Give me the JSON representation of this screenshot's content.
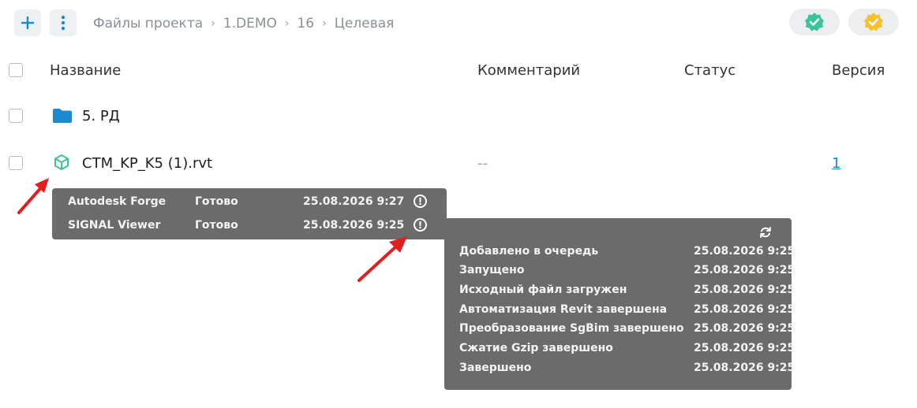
{
  "toolbar": {
    "add_icon": "plus-icon",
    "menu_icon": "vertical-dots-icon"
  },
  "breadcrumb": [
    "Файлы проекта",
    "1.DEMO",
    "16",
    "Целевая"
  ],
  "status_pills": [
    {
      "icon": "check-badge-icon",
      "color": "#3cc39a"
    },
    {
      "icon": "check-badge-icon",
      "color": "#f2c230"
    }
  ],
  "table": {
    "headers": {
      "name": "Название",
      "comment": "Комментарий",
      "status": "Статус",
      "version": "Версия"
    },
    "rows": [
      {
        "type": "folder",
        "name": "5. РД"
      },
      {
        "type": "model",
        "name": "CTM_KP_K5 (1).rvt",
        "comment": "--",
        "version": "1"
      }
    ]
  },
  "viewer_tooltip": {
    "rows": [
      {
        "viewer": "Autodesk Forge",
        "status": "Готово",
        "time": "25.08.2026 9:27"
      },
      {
        "viewer": "SIGNAL Viewer",
        "status": "Готово",
        "time": "25.08.2026 9:25"
      }
    ]
  },
  "process_tooltip": {
    "refresh_icon": "refresh-icon",
    "steps": [
      {
        "label": "Добавлено в очередь",
        "time": "25.08.2026 9:25"
      },
      {
        "label": "Запущено",
        "time": "25.08.2026 9:25"
      },
      {
        "label": "Исходный файл загружен",
        "time": "25.08.2026 9:25"
      },
      {
        "label": "Автоматизация Revit завершена",
        "time": "25.08.2026 9:25"
      },
      {
        "label": "Преобразование SgBim завершено",
        "time": "25.08.2026 9:25"
      },
      {
        "label": "Сжатие Gzip завершено",
        "time": "25.08.2026 9:25"
      },
      {
        "label": "Завершено",
        "time": "25.08.2026 9:25"
      }
    ]
  },
  "colors": {
    "accent": "#1a8bd1",
    "folder": "#1a8bd1",
    "model_icon": "#3cc39a",
    "tooltip_bg": "#6b6b6b",
    "annotation_arrow": "#e02020"
  }
}
